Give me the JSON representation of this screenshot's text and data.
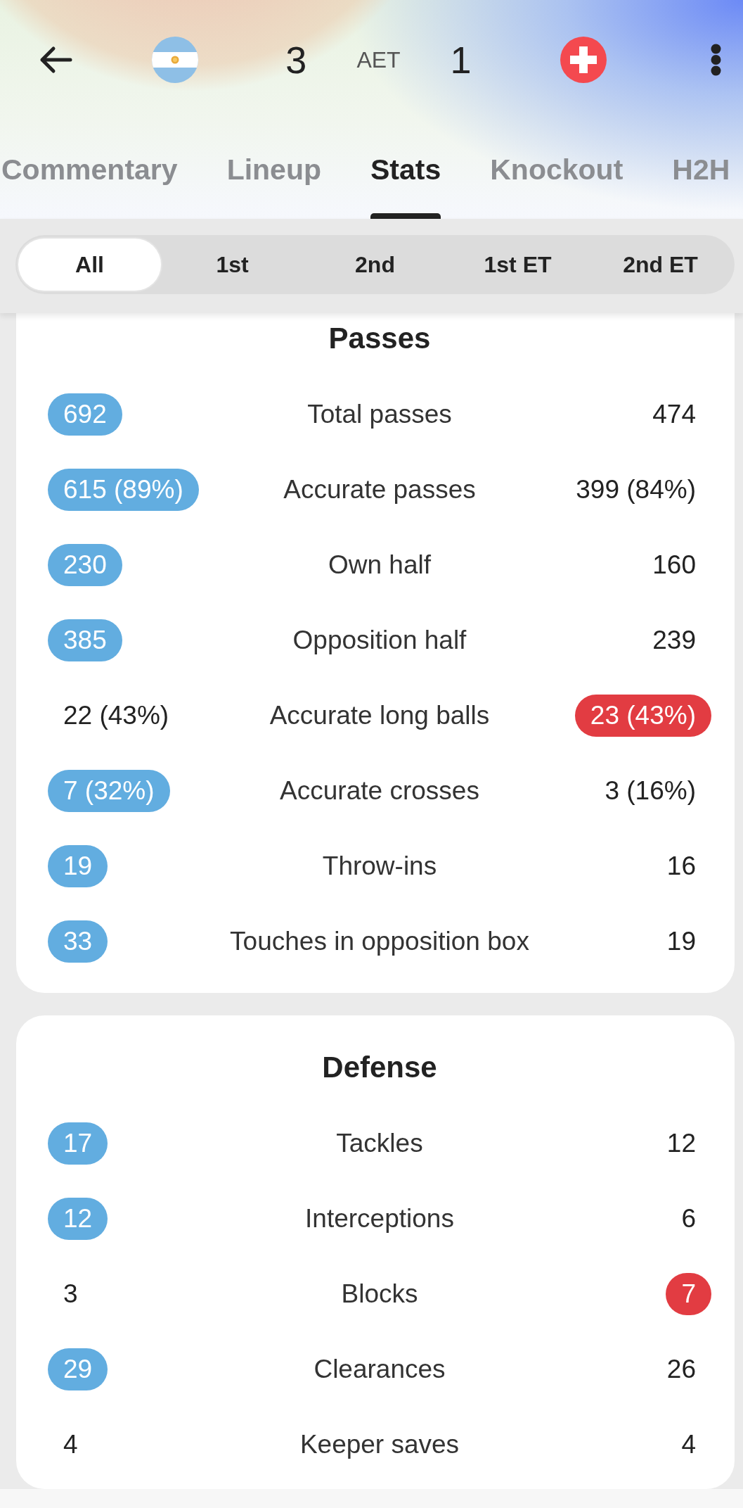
{
  "header": {
    "home_score": "3",
    "status": "AET",
    "away_score": "1"
  },
  "tabs": [
    {
      "label": "Commentary",
      "selected": false
    },
    {
      "label": "Lineup",
      "selected": false
    },
    {
      "label": "Stats",
      "selected": true
    },
    {
      "label": "Knockout",
      "selected": false
    },
    {
      "label": "H2H",
      "selected": false
    }
  ],
  "periods": [
    {
      "label": "All",
      "selected": true
    },
    {
      "label": "1st",
      "selected": false
    },
    {
      "label": "2nd",
      "selected": false
    },
    {
      "label": "1st ET",
      "selected": false
    },
    {
      "label": "2nd ET",
      "selected": false
    }
  ],
  "sections": [
    {
      "title": "Passes",
      "rows": [
        {
          "home": {
            "value": "692",
            "highlighted": true
          },
          "label": "Total passes",
          "away": {
            "value": "474",
            "highlighted": false
          }
        },
        {
          "home": {
            "value": "615 (89%)",
            "highlighted": true
          },
          "label": "Accurate passes",
          "away": {
            "value": "399 (84%)",
            "highlighted": false
          }
        },
        {
          "home": {
            "value": "230",
            "highlighted": true
          },
          "label": "Own half",
          "away": {
            "value": "160",
            "highlighted": false
          }
        },
        {
          "home": {
            "value": "385",
            "highlighted": true
          },
          "label": "Opposition half",
          "away": {
            "value": "239",
            "highlighted": false
          }
        },
        {
          "home": {
            "value": "22 (43%)",
            "highlighted": false
          },
          "label": "Accurate long balls",
          "away": {
            "value": "23 (43%)",
            "highlighted": true
          }
        },
        {
          "home": {
            "value": "7 (32%)",
            "highlighted": true
          },
          "label": "Accurate crosses",
          "away": {
            "value": "3 (16%)",
            "highlighted": false
          }
        },
        {
          "home": {
            "value": "19",
            "highlighted": true
          },
          "label": "Throw-ins",
          "away": {
            "value": "16",
            "highlighted": false
          }
        },
        {
          "home": {
            "value": "33",
            "highlighted": true
          },
          "label": "Touches in opposition box",
          "away": {
            "value": "19",
            "highlighted": false
          }
        }
      ]
    },
    {
      "title": "Defense",
      "rows": [
        {
          "home": {
            "value": "17",
            "highlighted": true
          },
          "label": "Tackles",
          "away": {
            "value": "12",
            "highlighted": false
          }
        },
        {
          "home": {
            "value": "12",
            "highlighted": true
          },
          "label": "Interceptions",
          "away": {
            "value": "6",
            "highlighted": false
          }
        },
        {
          "home": {
            "value": "3",
            "highlighted": false
          },
          "label": "Blocks",
          "away": {
            "value": "7",
            "highlighted": true
          }
        },
        {
          "home": {
            "value": "29",
            "highlighted": true
          },
          "label": "Clearances",
          "away": {
            "value": "26",
            "highlighted": false
          }
        },
        {
          "home": {
            "value": "4",
            "highlighted": false
          },
          "label": "Keeper saves",
          "away": {
            "value": "4",
            "highlighted": false
          }
        }
      ]
    }
  ]
}
